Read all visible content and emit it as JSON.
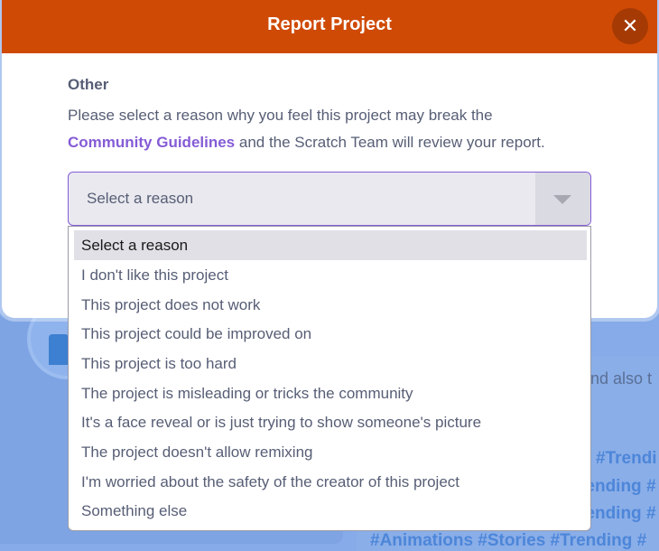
{
  "background": {
    "also_text": "nd also t",
    "tag_lines": [
      "#Trendi",
      "rending #",
      "rending #",
      "#Animations #Stories #Trending #"
    ]
  },
  "modal": {
    "title": "Report Project",
    "close_icon": "close-icon",
    "section_label": "Other",
    "description_before": "Please select a reason why you feel this project may break the",
    "description_link": "Community Guidelines",
    "description_after": " and the Scratch Team will review your report.",
    "select": {
      "value": "Select a reason"
    },
    "options": [
      "Select a reason",
      "I don't like this project",
      "This project does not work",
      "This project could be improved on",
      "This project is too hard",
      "The project is misleading or tricks the community",
      "It's a face reveal or is just trying to show someone's picture",
      "The project doesn't allow remixing",
      "I'm worried about the safety of the creator of this project",
      "Something else"
    ],
    "selected_index": 0
  },
  "colors": {
    "header": "#cf4a05",
    "link": "#855cd6",
    "text": "#575e75"
  }
}
